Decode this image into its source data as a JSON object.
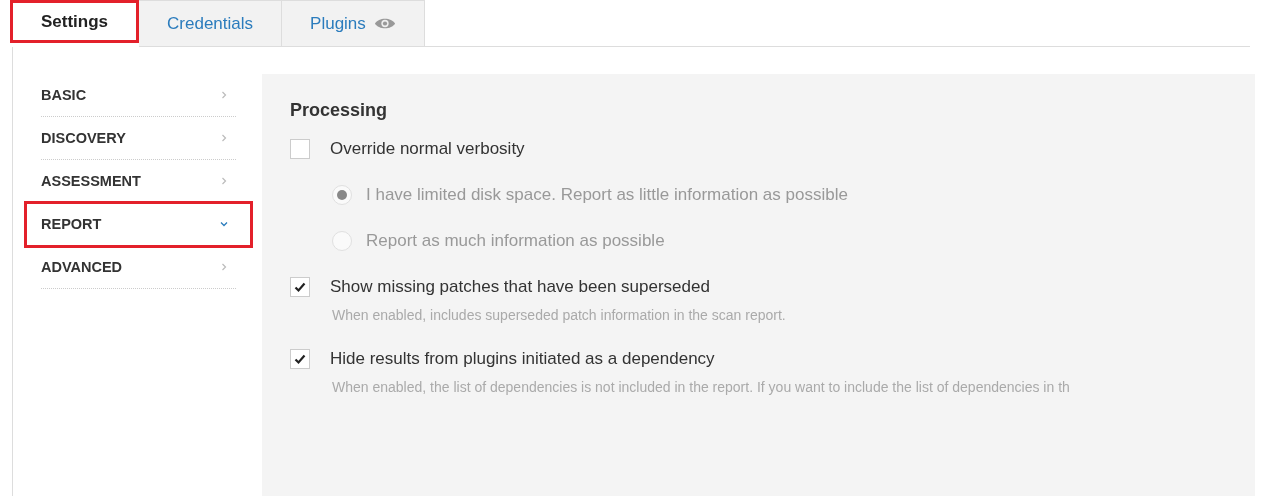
{
  "tabs": [
    {
      "label": "Settings",
      "selected": true,
      "highlighted": true
    },
    {
      "label": "Credentials",
      "selected": false,
      "highlighted": false
    },
    {
      "label": "Plugins",
      "selected": false,
      "highlighted": false,
      "eye": true
    }
  ],
  "sidebar": {
    "items": [
      {
        "label": "BASIC",
        "expanded": false,
        "highlighted": false
      },
      {
        "label": "DISCOVERY",
        "expanded": false,
        "highlighted": false
      },
      {
        "label": "ASSESSMENT",
        "expanded": false,
        "highlighted": false
      },
      {
        "label": "REPORT",
        "expanded": true,
        "highlighted": true
      },
      {
        "label": "ADVANCED",
        "expanded": false,
        "highlighted": false
      }
    ]
  },
  "section": {
    "title": "Processing",
    "options": [
      {
        "kind": "checkbox",
        "label": "Override normal verbosity",
        "checked": false,
        "radios": [
          {
            "label": "I have limited disk space. Report as little information as possible",
            "selected": true,
            "disabled": true
          },
          {
            "label": "Report as much information as possible",
            "selected": false,
            "disabled": true
          }
        ]
      },
      {
        "kind": "checkbox",
        "label": "Show missing patches that have been superseded",
        "checked": true,
        "description": "When enabled, includes superseded patch information in the scan report."
      },
      {
        "kind": "checkbox",
        "label": "Hide results from plugins initiated as a dependency",
        "checked": true,
        "description": "When enabled, the list of dependencies is not included in the report. If you want to include the list of dependencies in th"
      }
    ]
  }
}
